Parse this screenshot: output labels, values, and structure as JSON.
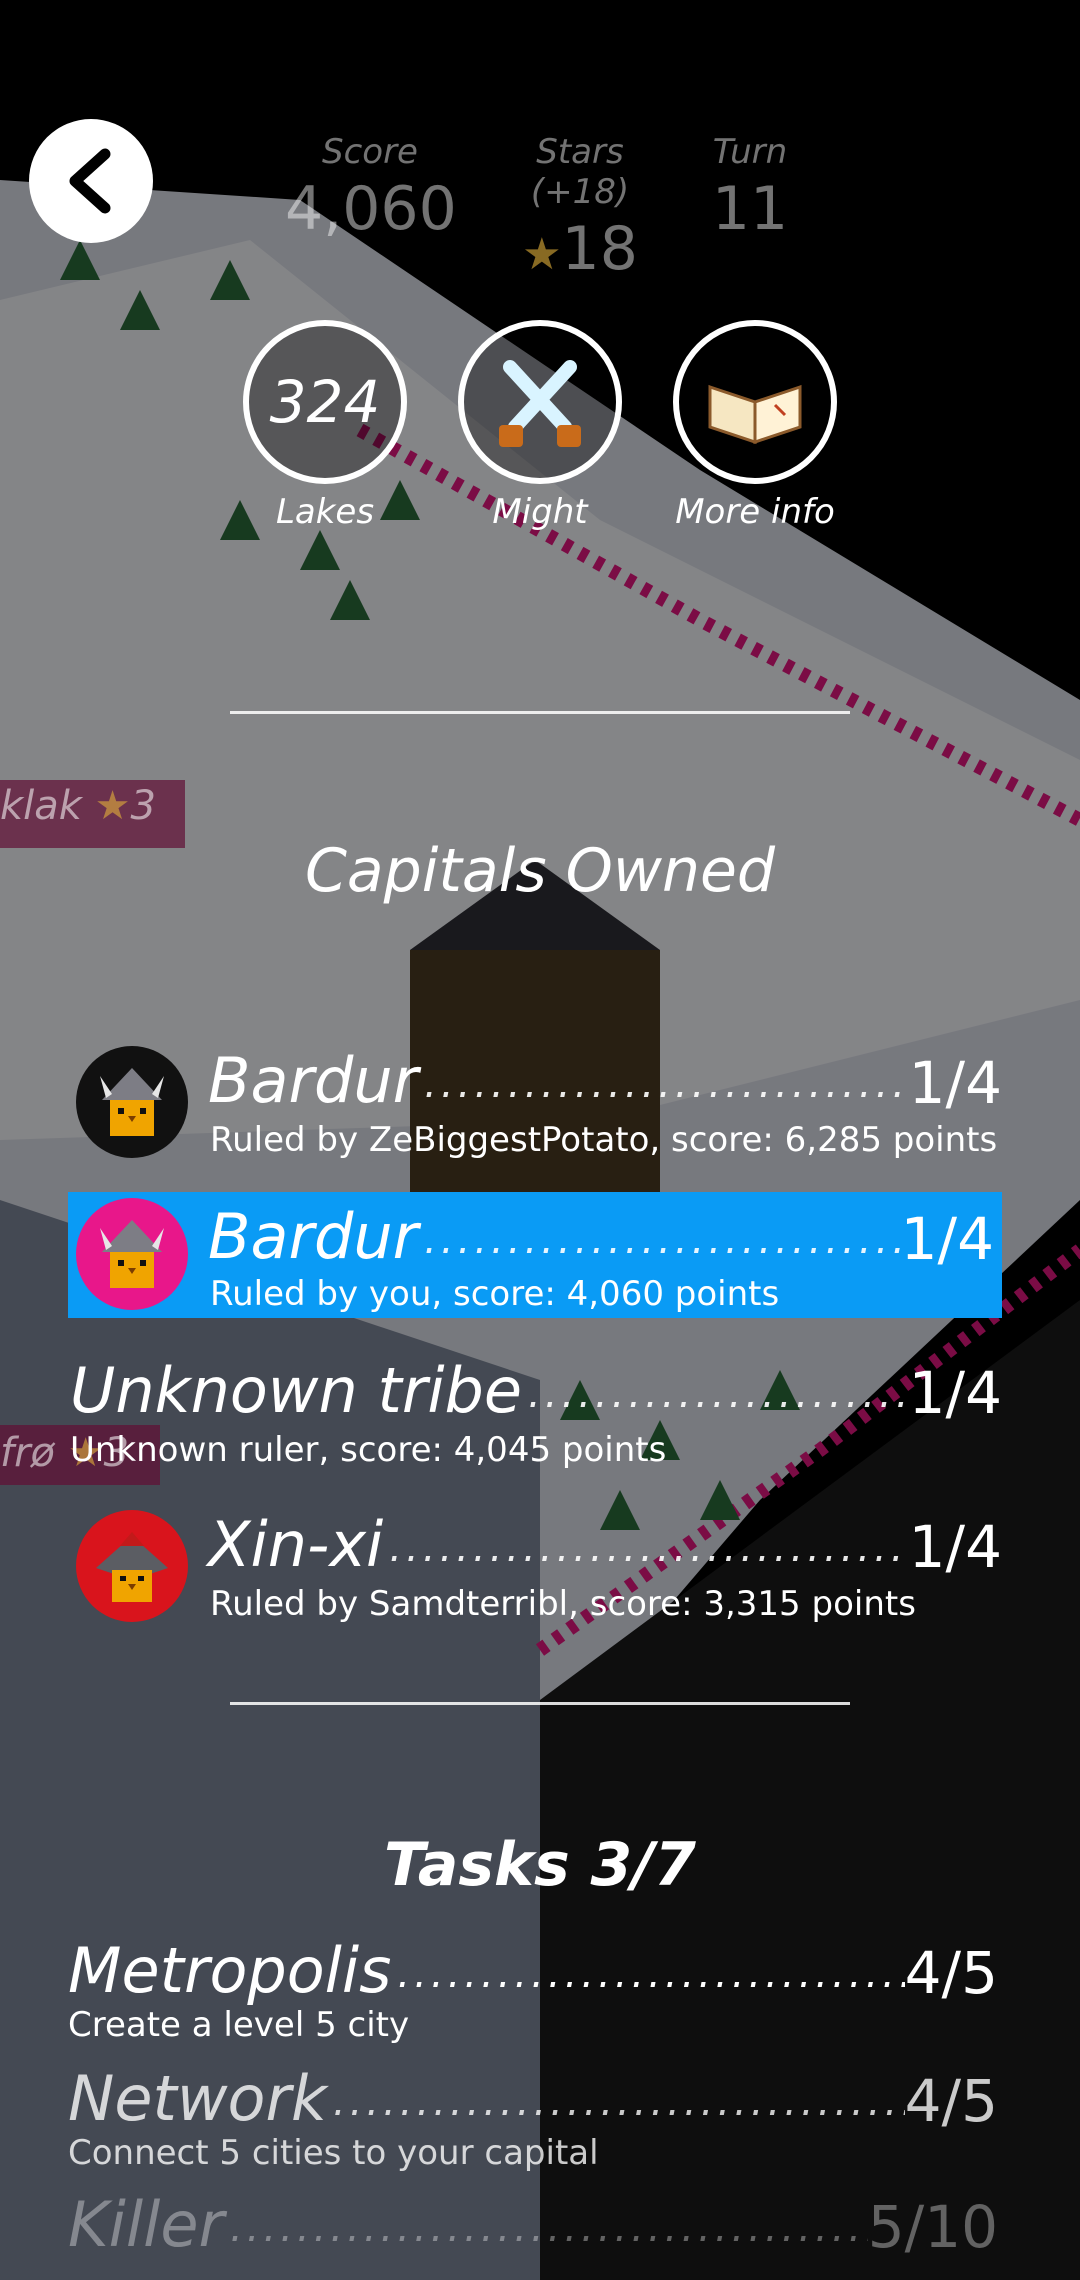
{
  "header": {
    "score_label": "Score",
    "score_value": "4,060",
    "stars_label": "Stars (+18)",
    "stars_value": "18",
    "turn_label": "Turn",
    "turn_value": "11"
  },
  "quick_buttons": [
    {
      "label": "Lakes",
      "value": "324",
      "icon": "number"
    },
    {
      "label": "Might",
      "icon": "crossed-swords-icon"
    },
    {
      "label": "More info",
      "icon": "open-book-icon"
    }
  ],
  "capitals": {
    "title": "Capitals Owned",
    "rows": [
      {
        "tribe": "Bardur",
        "ratio": "1/4",
        "subtitle": "Ruled by ZeBiggestPotato, score: 6,285 points",
        "avatar_bg": "#111111",
        "highlighted": false
      },
      {
        "tribe": "Bardur",
        "ratio": "1/4",
        "subtitle": "Ruled by you, score: 4,060 points",
        "avatar_bg": "#e8178a",
        "highlighted": true
      },
      {
        "tribe": "Unknown tribe",
        "ratio": "1/4",
        "subtitle": "Unknown ruler, score: 4,045 points",
        "avatar_bg": "",
        "highlighted": false
      },
      {
        "tribe": "Xin-xi",
        "ratio": "1/4",
        "subtitle": "Ruled by Samdterribl, score: 3,315 points",
        "avatar_bg": "#d9141c",
        "highlighted": false
      }
    ]
  },
  "tasks": {
    "title": "Tasks 3/7",
    "items": [
      {
        "name": "Metropolis",
        "ratio": "4/5",
        "subtitle": "Create a level 5 city"
      },
      {
        "name": "Network",
        "ratio": "4/5",
        "subtitle": "Connect 5 cities to your capital"
      },
      {
        "name": "Killer",
        "ratio": "5/10",
        "subtitle": ""
      }
    ]
  },
  "map_labels": {
    "city_left_1": "klak",
    "city_left_1_level": "3",
    "city_left_2": "frø",
    "city_left_2_level": "3"
  },
  "colors": {
    "highlight": "#0a9bf5",
    "background": "#000000"
  }
}
